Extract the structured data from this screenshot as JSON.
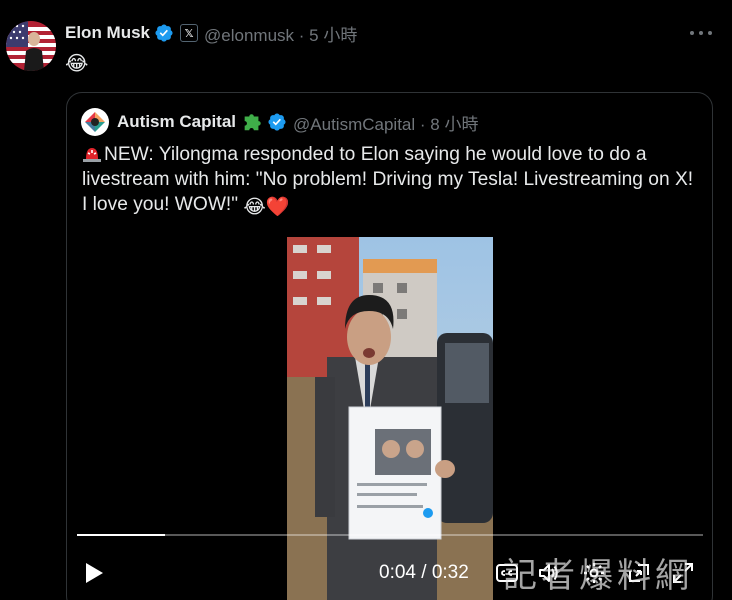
{
  "post": {
    "author_name": "Elon Musk",
    "handle_time": "@elonmusk · 5 小時",
    "badge_label": "𝕏",
    "text": "😂"
  },
  "quote": {
    "author_name": "Autism Capital",
    "handle_time": "@AutismCapital · 8 小時",
    "text_main": "NEW: Yilongma responded to Elon saying he would love to do a livestream with him: \"No problem! Driving my Tesla! Livestreaming on X! I love you! WOW!\"",
    "text_emoji": "😂❤️"
  },
  "video": {
    "progress": 0.14,
    "time_current": "0:04",
    "time_separator": " / ",
    "time_total": "0:32"
  },
  "watermark": "記者爆料網",
  "colors": {
    "verified": "#1d9bf0",
    "muted": "#71767b",
    "border": "#2f3336",
    "text": "#e7e9ea",
    "puzzle": "#3fae49"
  },
  "icons": [
    "verified-icon",
    "x-badge-icon",
    "more-icon",
    "puzzle-icon",
    "siren-icon",
    "play-icon",
    "captions-icon",
    "volume-icon",
    "settings-icon",
    "pip-icon",
    "fullscreen-icon"
  ]
}
